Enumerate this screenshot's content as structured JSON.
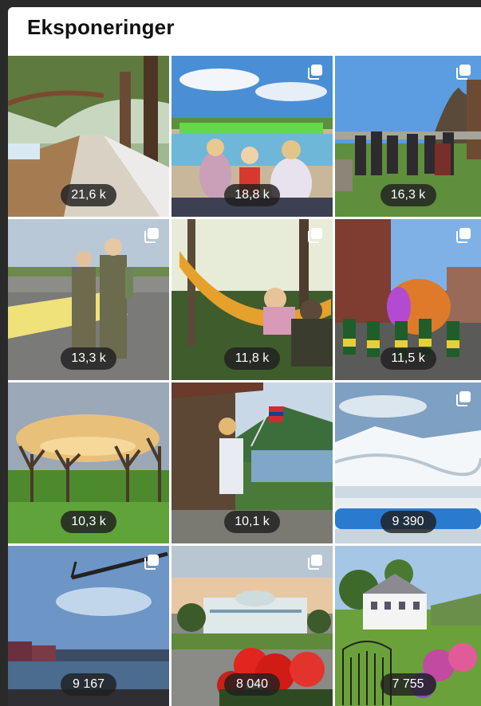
{
  "header": {
    "title": "Eksponeringer"
  },
  "tiles": [
    {
      "metric": "21,6 k",
      "scene": "forest-boardwalk"
    },
    {
      "metric": "18,8 k",
      "scene": "kids-waterpark"
    },
    {
      "metric": "16,3 k",
      "scene": "crowd-church"
    },
    {
      "metric": "13,3 k",
      "scene": "pilots-runway"
    },
    {
      "metric": "11,8 k",
      "scene": "hammock-forest"
    },
    {
      "metric": "11,5 k",
      "scene": "parade-balloon"
    },
    {
      "metric": "10,3 k",
      "scene": "orchard-sunset"
    },
    {
      "metric": "10,1 k",
      "scene": "fjord-flag"
    },
    {
      "metric": "9 390",
      "scene": "snow-mountains"
    },
    {
      "metric": "9 167",
      "scene": "harbor-crane"
    },
    {
      "metric": "8 040",
      "scene": "manor-roses"
    },
    {
      "metric": "7 755",
      "scene": "white-farmhouse"
    }
  ]
}
